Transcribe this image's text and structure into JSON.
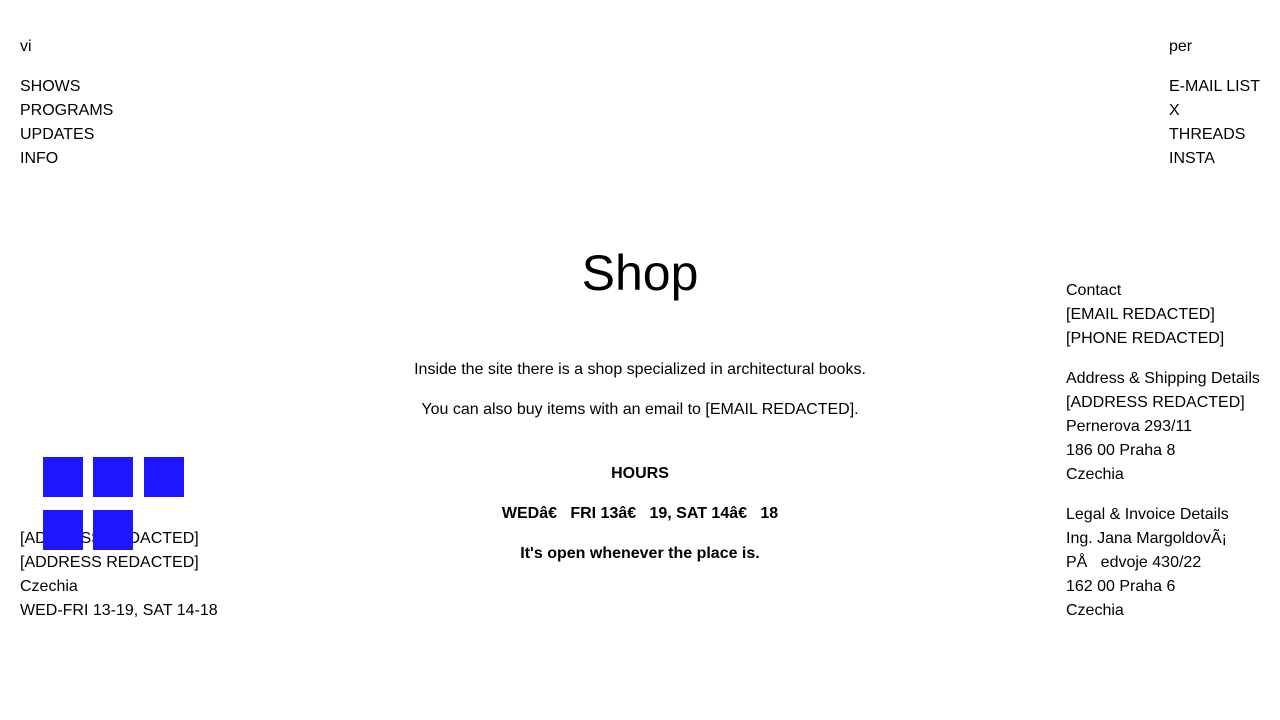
{
  "left_header": {
    "brand": "vi",
    "nav": [
      "SHOWS",
      "PROGRAMS",
      "UPDATES",
      "INFO"
    ]
  },
  "right_header": {
    "brand": "per",
    "links": [
      "E-MAIL LIST",
      "X",
      "THREADS",
      "INSTA"
    ]
  },
  "main": {
    "title": "Shop",
    "paragraph1": "Inside the site there is a shop specialized in architectural books.",
    "paragraph2": "You can also buy items with an email to [EMAIL REDACTED].",
    "hours_title": "HOURS",
    "hours_line": "WEDâ€   FRI 13â€   19, SAT 14â€   18",
    "hours_note": "It's open whenever the place is."
  },
  "contact": {
    "title": "Contact",
    "email": "[EMAIL REDACTED]",
    "phone": "[PHONE REDACTED]"
  },
  "shipping": {
    "title": "Address & Shipping Details",
    "line1": "[ADDRESS REDACTED]",
    "line2": "Pernerova 293/11",
    "line3": "186 00 Praha 8",
    "line4": "Czechia"
  },
  "legal": {
    "title": "Legal & Invoice Details",
    "line1": "Ing. Jana MargoldovÃ¡",
    "line2": "PÅ   edvoje 430/22",
    "line3": "162 00 Praha 6",
    "line4": "Czechia"
  },
  "footer_address": {
    "line1": "[ADDRESS REDACTED]",
    "line2": "[ADDRESS REDACTED]",
    "line3": "Czechia",
    "line4": "WED-FRI 13-19, SAT 14-18"
  },
  "colors": {
    "accent_square": "#1e16ff"
  }
}
